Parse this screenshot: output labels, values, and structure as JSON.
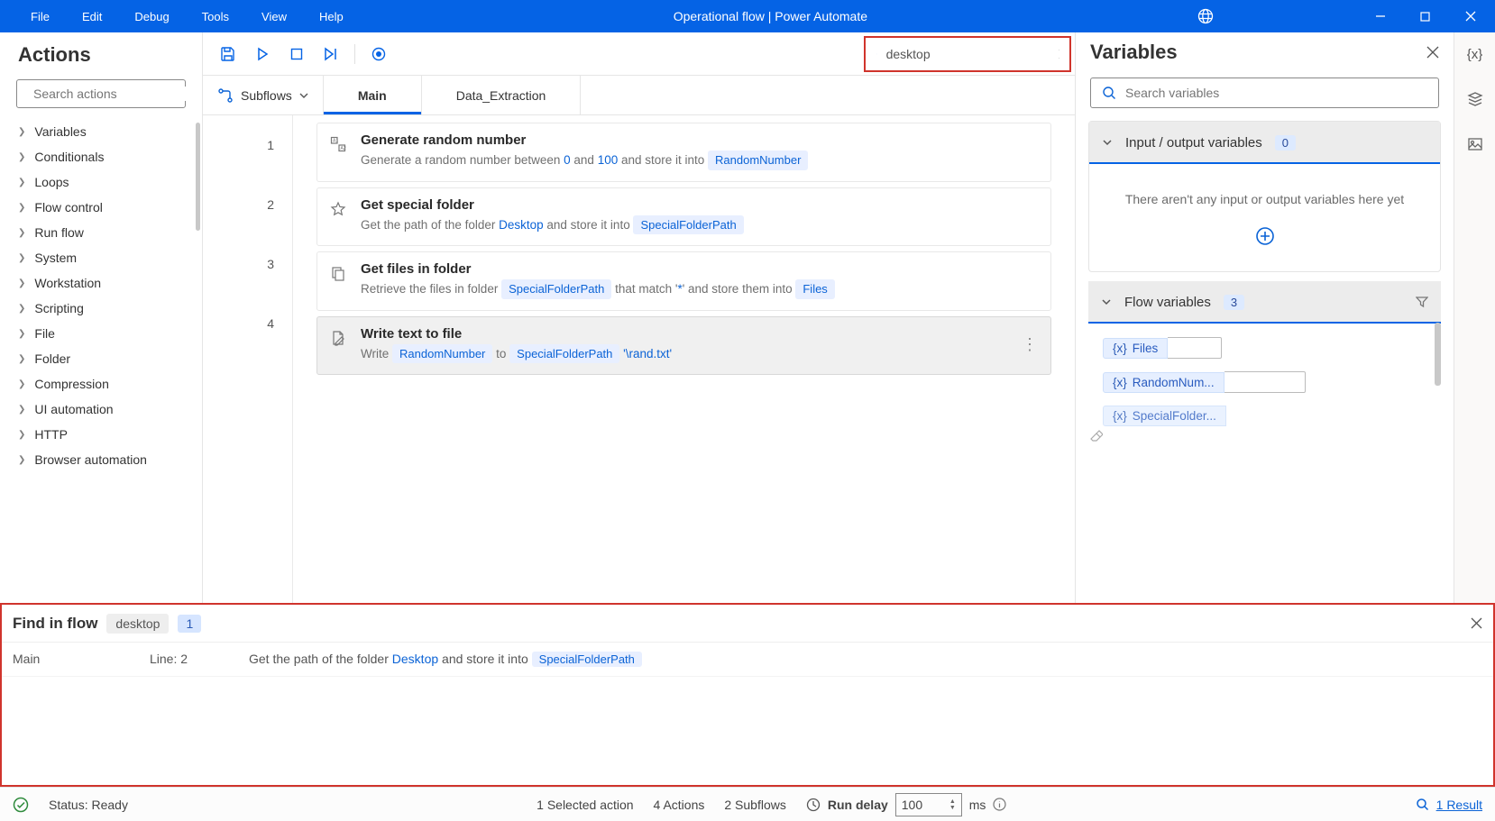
{
  "title": "Operational flow | Power Automate",
  "menu": [
    "File",
    "Edit",
    "Debug",
    "Tools",
    "View",
    "Help"
  ],
  "actions": {
    "header": "Actions",
    "search_placeholder": "Search actions",
    "categories": [
      "Variables",
      "Conditionals",
      "Loops",
      "Flow control",
      "Run flow",
      "System",
      "Workstation",
      "Scripting",
      "File",
      "Folder",
      "Compression",
      "UI automation",
      "HTTP",
      "Browser automation"
    ]
  },
  "toolbar": {
    "search_value": "desktop"
  },
  "subflows_label": "Subflows",
  "tabs": [
    {
      "label": "Main",
      "active": true
    },
    {
      "label": "Data_Extraction",
      "active": false
    }
  ],
  "steps": [
    {
      "num": "1",
      "title": "Generate random number",
      "desc_pre": "Generate a random number between ",
      "p1": "0",
      "mid1": " and ",
      "p2": "100",
      "mid2": " and store it into ",
      "var": "RandomNumber",
      "selected": false
    },
    {
      "num": "2",
      "title": "Get special folder",
      "desc_pre": "Get the path of the folder ",
      "p1": "Desktop",
      "mid1": " and store it into ",
      "p2": "",
      "mid2": "",
      "var": "SpecialFolderPath",
      "selected": false
    },
    {
      "num": "3",
      "title": "Get files in folder",
      "desc_pre": "Retrieve the files in folder ",
      "var1": "SpecialFolderPath",
      "mid1": " that match '",
      "p1": "*",
      "mid2": "' and store them into ",
      "var": "Files",
      "selected": false
    },
    {
      "num": "4",
      "title": "Write text to file",
      "desc_pre": "Write ",
      "var1": "RandomNumber",
      "mid1": " to ",
      "var2": "SpecialFolderPath",
      "tail": "'\\rand.txt'",
      "selected": true
    }
  ],
  "vars": {
    "header": "Variables",
    "search_placeholder": "Search variables",
    "io_header": "Input / output variables",
    "io_count": "0",
    "io_empty": "There aren't any input or output variables here yet",
    "flow_header": "Flow variables",
    "flow_count": "3",
    "flow_vars": [
      "Files",
      "RandomNum...",
      "SpecialFolder..."
    ]
  },
  "find": {
    "title": "Find in flow",
    "term": "desktop",
    "count": "1",
    "row_main": "Main",
    "row_line": "Line: 2",
    "row_desc_pre": "Get the path of the folder ",
    "row_kw": "Desktop",
    "row_mid": " and store it into ",
    "row_var": "SpecialFolderPath"
  },
  "status": {
    "ready": "Status: Ready",
    "selected": "1 Selected action",
    "actions_count": "4 Actions",
    "subflows": "2 Subflows",
    "run_delay_label": "Run delay",
    "run_delay_value": "100",
    "ms": "ms",
    "result": "1 Result"
  }
}
